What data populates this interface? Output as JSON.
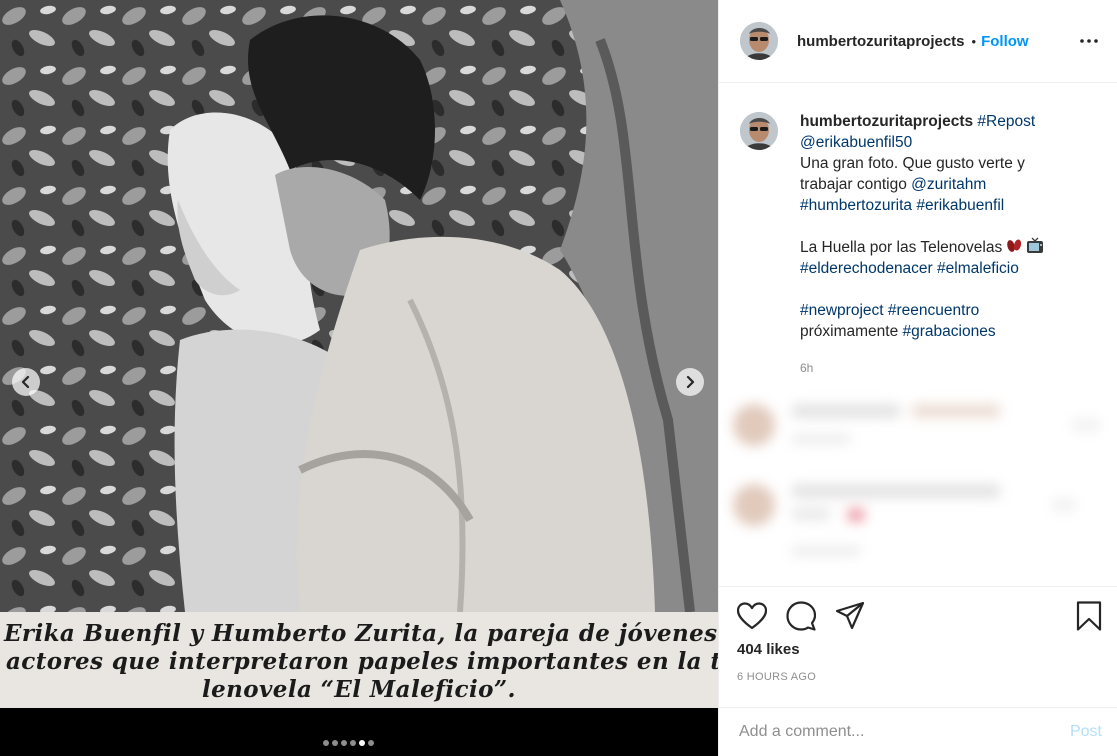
{
  "media": {
    "caption_lines": [
      "Erika Buenfil y Humberto Zurita, la pareja de jóvenes",
      "actores que interpretaron papeles importantes en la te-",
      "lenovela “El Maleficio”."
    ],
    "carousel": {
      "total": 6,
      "active_index": 5
    }
  },
  "header": {
    "username": "humbertozuritaprojects",
    "separator": "•",
    "follow_label": "Follow"
  },
  "caption": {
    "username": "humbertozuritaprojects",
    "line1_tag": "#Repost",
    "line2_mention": "@erikabuenfil50",
    "line3": "Una gran foto. Que gusto verte y",
    "line4_text": "trabajar contigo",
    "line4_mention": "@zuritahm",
    "line5_tag1": "#humbertozurita",
    "line5_tag2": "#erikabuenfil",
    "line6_text": "La Huella por las Telenovelas",
    "line7_tag1": "#elderechodenacer",
    "line7_tag2": "#elmaleficio",
    "line8_tag1": "#newproject",
    "line8_tag2": "#reencuentro",
    "line9_text": "próximamente",
    "line9_tag": "#grabaciones",
    "time": "6h"
  },
  "stats": {
    "likes": "404 likes",
    "posted_ago": "6 HOURS AGO"
  },
  "comment_box": {
    "placeholder": "Add a comment...",
    "post_label": "Post"
  },
  "colors": {
    "link": "#00376b",
    "follow": "#0095f6",
    "muted": "#8e8e8e",
    "post_disabled": "#b2dffc"
  },
  "icons": [
    "chevron-left-icon",
    "chevron-right-icon",
    "more-options-icon",
    "heart-icon",
    "comment-icon",
    "share-icon",
    "bookmark-icon",
    "footprints-emoji-icon",
    "television-emoji-icon"
  ]
}
